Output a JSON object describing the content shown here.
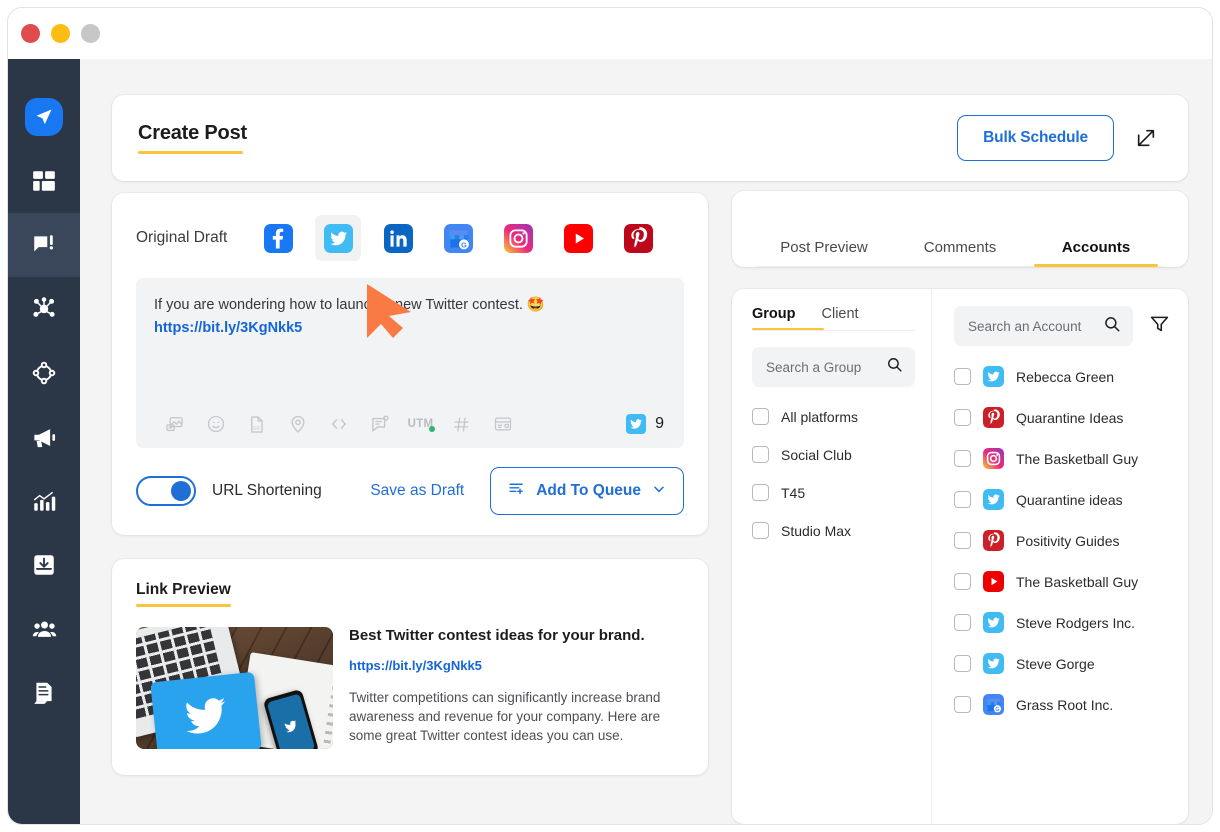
{
  "window": {
    "dots": [
      "close",
      "minimize",
      "maximize"
    ]
  },
  "sidebar": {
    "items": [
      {
        "name": "logo",
        "icon": "paper-plane-icon",
        "active": false
      },
      {
        "name": "dashboard",
        "icon": "grid-dashboard-icon",
        "active": false
      },
      {
        "name": "compose",
        "icon": "chat-edit-icon",
        "active": true
      },
      {
        "name": "network",
        "icon": "network-share-icon",
        "active": false
      },
      {
        "name": "discovery",
        "icon": "circle-nodes-icon",
        "active": false
      },
      {
        "name": "campaigns",
        "icon": "megaphone-icon",
        "active": false
      },
      {
        "name": "analytics",
        "icon": "bar-chart-icon",
        "active": false
      },
      {
        "name": "inbox",
        "icon": "inbox-download-icon",
        "active": false
      },
      {
        "name": "team",
        "icon": "people-group-icon",
        "active": false
      },
      {
        "name": "reports",
        "icon": "document-icon",
        "active": false
      }
    ]
  },
  "header": {
    "title": "Create Post",
    "bulk_schedule_label": "Bulk Schedule",
    "collapse_icon": "arrow-into-box-icon"
  },
  "composer": {
    "draft_label": "Original Draft",
    "platforms": [
      {
        "name": "facebook",
        "selected": false,
        "color": "#1877f2"
      },
      {
        "name": "twitter",
        "selected": true,
        "color": "#1da1f2"
      },
      {
        "name": "linkedin",
        "selected": false,
        "color": "#0a66c2"
      },
      {
        "name": "google-business",
        "selected": false,
        "color": "#4285f4"
      },
      {
        "name": "instagram",
        "selected": false,
        "color": "#e1306c"
      },
      {
        "name": "youtube",
        "selected": false,
        "color": "#ff0000"
      },
      {
        "name": "pinterest",
        "selected": false,
        "color": "#bd081c"
      }
    ],
    "text": "If you are wondering how to launch a new Twitter contest. 🤩",
    "link": "https://bit.ly/3KgNkk5",
    "tools": [
      "image-icon",
      "emoji-icon",
      "gif-icon",
      "location-icon",
      "code-icon",
      "note-icon",
      "utm-icon",
      "hashtag-icon",
      "template-icon"
    ],
    "utm_label": "UTM",
    "char_count": "9",
    "char_platform": "twitter",
    "url_shortening_label": "URL Shortening",
    "url_shortening_on": true,
    "save_draft_label": "Save as Draft",
    "add_to_queue_label": "Add To Queue"
  },
  "link_preview": {
    "section_title": "Link Preview",
    "headline": "Best Twitter contest ideas for your brand.",
    "url": "https://bit.ly/3KgNkk5",
    "description": "Twitter competitions can significantly increase brand awareness and revenue for your company. Here are some great Twitter contest ideas you can use."
  },
  "right_panel": {
    "tabs": [
      {
        "label": "Post Preview",
        "active": false
      },
      {
        "label": "Comments",
        "active": false
      },
      {
        "label": "Accounts",
        "active": true
      }
    ],
    "group": {
      "tabs": [
        {
          "label": "Group",
          "active": true
        },
        {
          "label": "Client",
          "active": false
        }
      ],
      "search_placeholder": "Search a Group",
      "search_value": "",
      "items": [
        {
          "label": "All platforms",
          "checked": false
        },
        {
          "label": "Social Club",
          "checked": false
        },
        {
          "label": "T45",
          "checked": false
        },
        {
          "label": "Studio Max",
          "checked": false
        }
      ]
    },
    "accounts": {
      "search_placeholder": "Search an Account",
      "search_value": "",
      "filter_icon": "filter-funnel-icon",
      "items": [
        {
          "label": "Rebecca Green",
          "platform": "twitter",
          "checked": false
        },
        {
          "label": "Quarantine Ideas",
          "platform": "pinterest",
          "checked": false
        },
        {
          "label": "The Basketball Guy",
          "platform": "instagram",
          "checked": false
        },
        {
          "label": "Quarantine ideas",
          "platform": "twitter",
          "checked": false
        },
        {
          "label": "Positivity Guides",
          "platform": "pinterest",
          "checked": false
        },
        {
          "label": "The Basketball Guy",
          "platform": "youtube",
          "checked": false
        },
        {
          "label": "Steve Rodgers Inc.",
          "platform": "twitter",
          "checked": false
        },
        {
          "label": "Steve Gorge",
          "platform": "twitter",
          "checked": false
        },
        {
          "label": "Grass Root Inc.",
          "platform": "google-business",
          "checked": false
        }
      ]
    }
  },
  "colors": {
    "accent_blue": "#1f6fd6",
    "accent_yellow": "#f9c53a",
    "sidebar_bg": "#2b3647",
    "page_bg": "#f4f4f5",
    "cursor": "#f97b43"
  }
}
